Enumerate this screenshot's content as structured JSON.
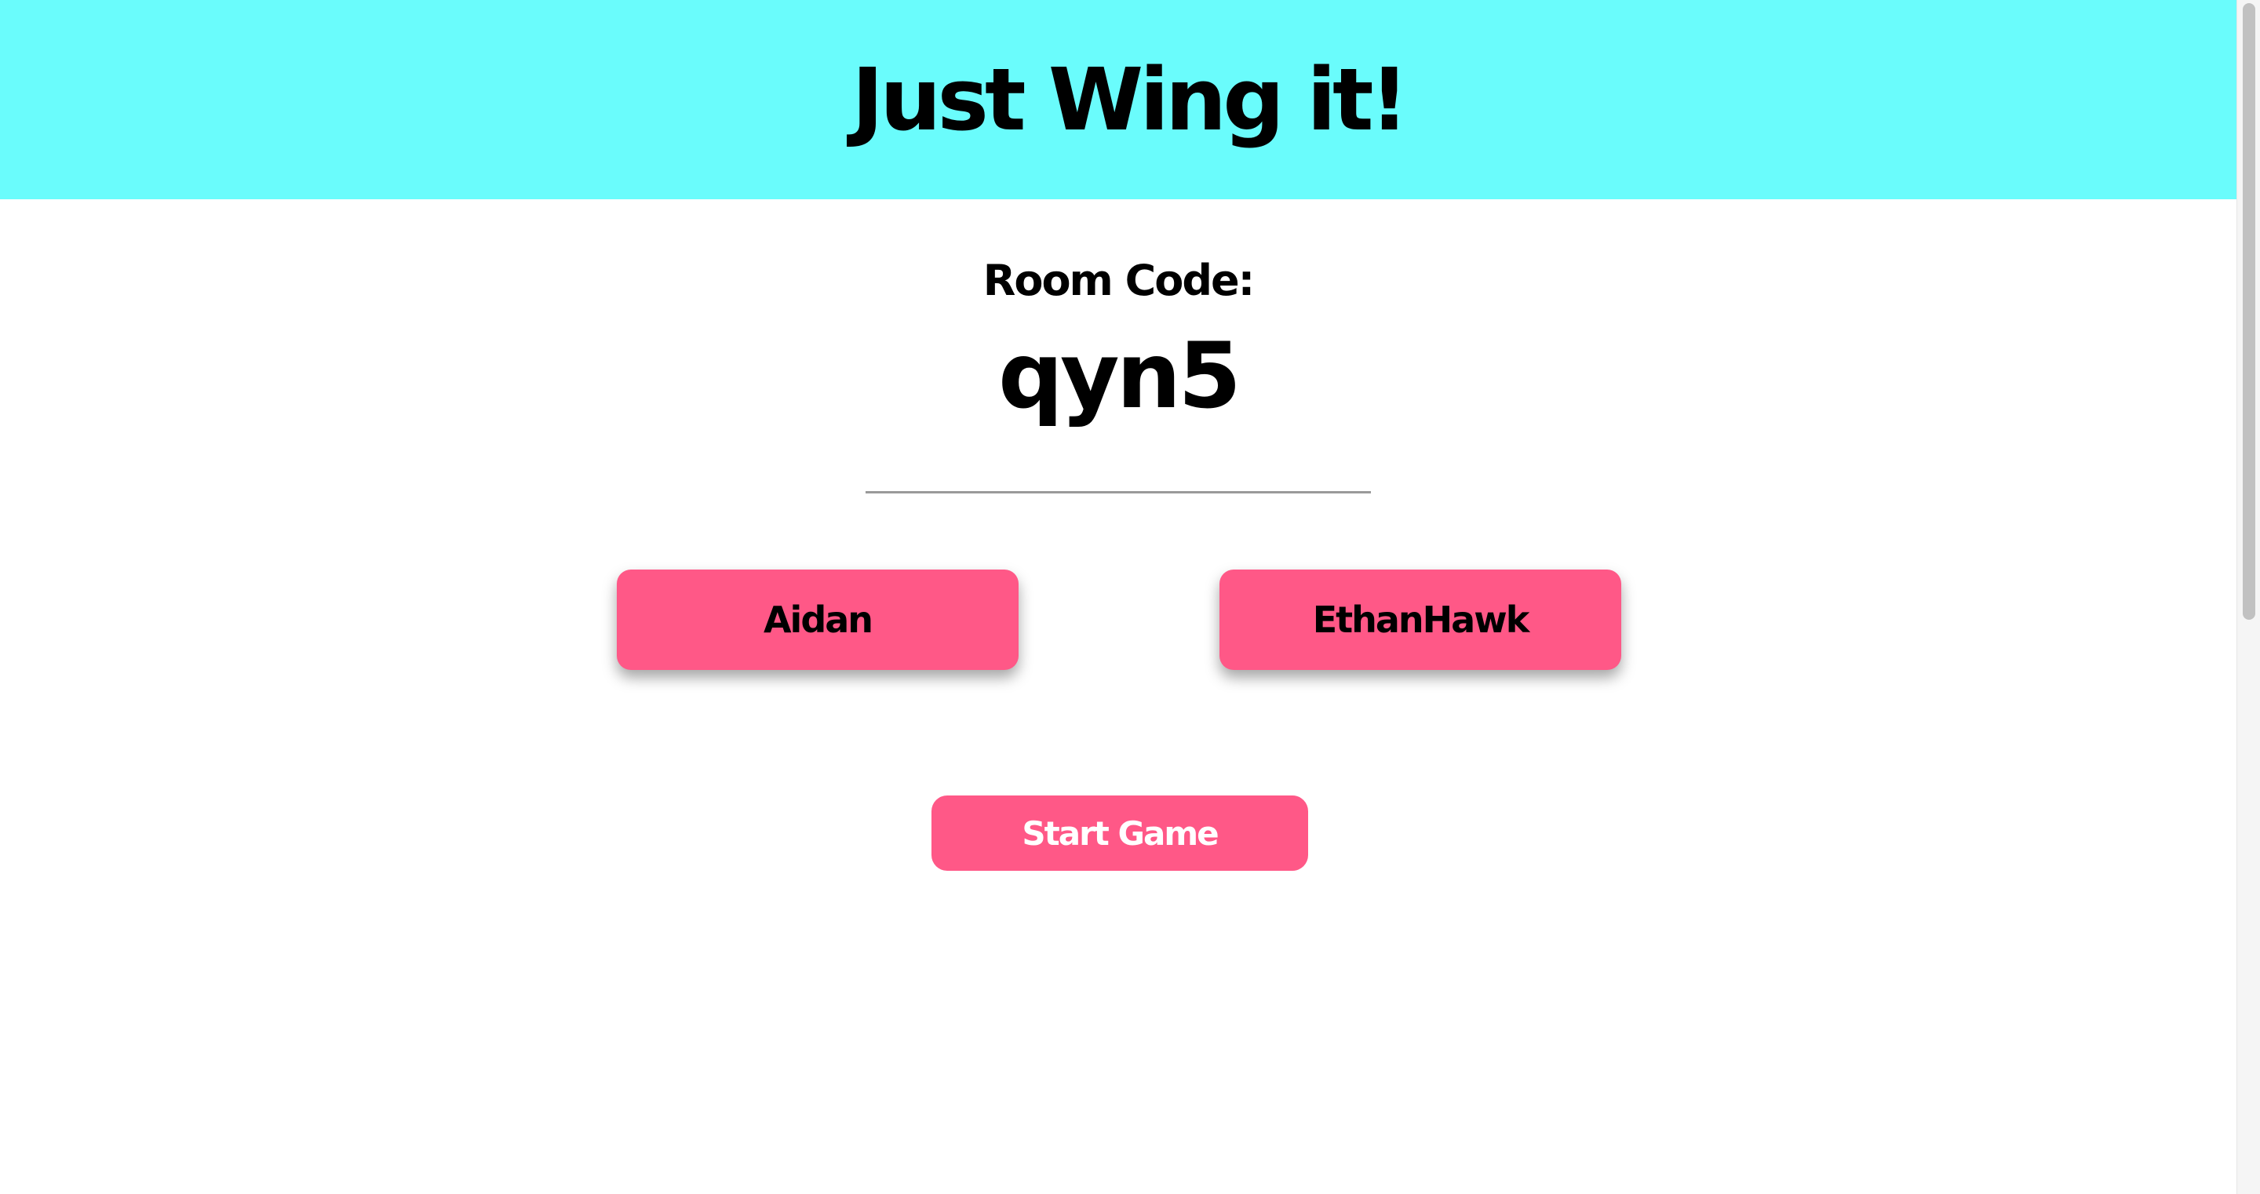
{
  "header": {
    "title": "Just Wing it!",
    "background_color": "#6afcfc"
  },
  "room": {
    "label": "Room Code:",
    "code": "qyn5"
  },
  "players": [
    {
      "name": "Aidan"
    },
    {
      "name": "EthanHawk"
    }
  ],
  "actions": {
    "start_label": "Start Game"
  },
  "colors": {
    "accent": "#ff5887",
    "header": "#6afcfc"
  }
}
